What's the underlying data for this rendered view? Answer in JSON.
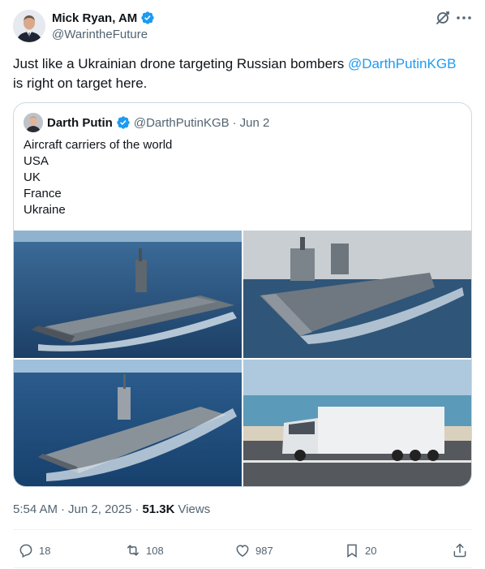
{
  "author": {
    "name": "Mick Ryan, AM",
    "handle": "@WarintheFuture"
  },
  "tweet": {
    "text_before": "Just like a Ukrainian drone targeting Russian bombers ",
    "mention": "@DarthPutinKGB",
    "text_after": " is right on target here."
  },
  "quote": {
    "name": "Darth Putin",
    "handle": "@DarthPutinKGB",
    "separator": "·",
    "date": "Jun 2",
    "lines": [
      "Aircraft carriers of the world",
      "USA",
      "UK",
      "France",
      "Ukraine"
    ]
  },
  "meta": {
    "time": "5:54 AM",
    "separator": "·",
    "date": "Jun 2, 2025",
    "separator2": "·",
    "views_count": "51.3K",
    "views_label": "Views"
  },
  "actions": {
    "replies": "18",
    "reposts": "108",
    "likes": "987",
    "bookmarks": "20"
  },
  "icons": [
    "verified-badge-icon",
    "grok-icon",
    "more-icon",
    "reply-icon",
    "repost-icon",
    "like-icon",
    "bookmark-icon",
    "share-icon"
  ],
  "colors": {
    "link": "#1d9bf0",
    "secondary_text": "#536471",
    "border": "#cfd9de",
    "verified": "#1d9bf0"
  }
}
